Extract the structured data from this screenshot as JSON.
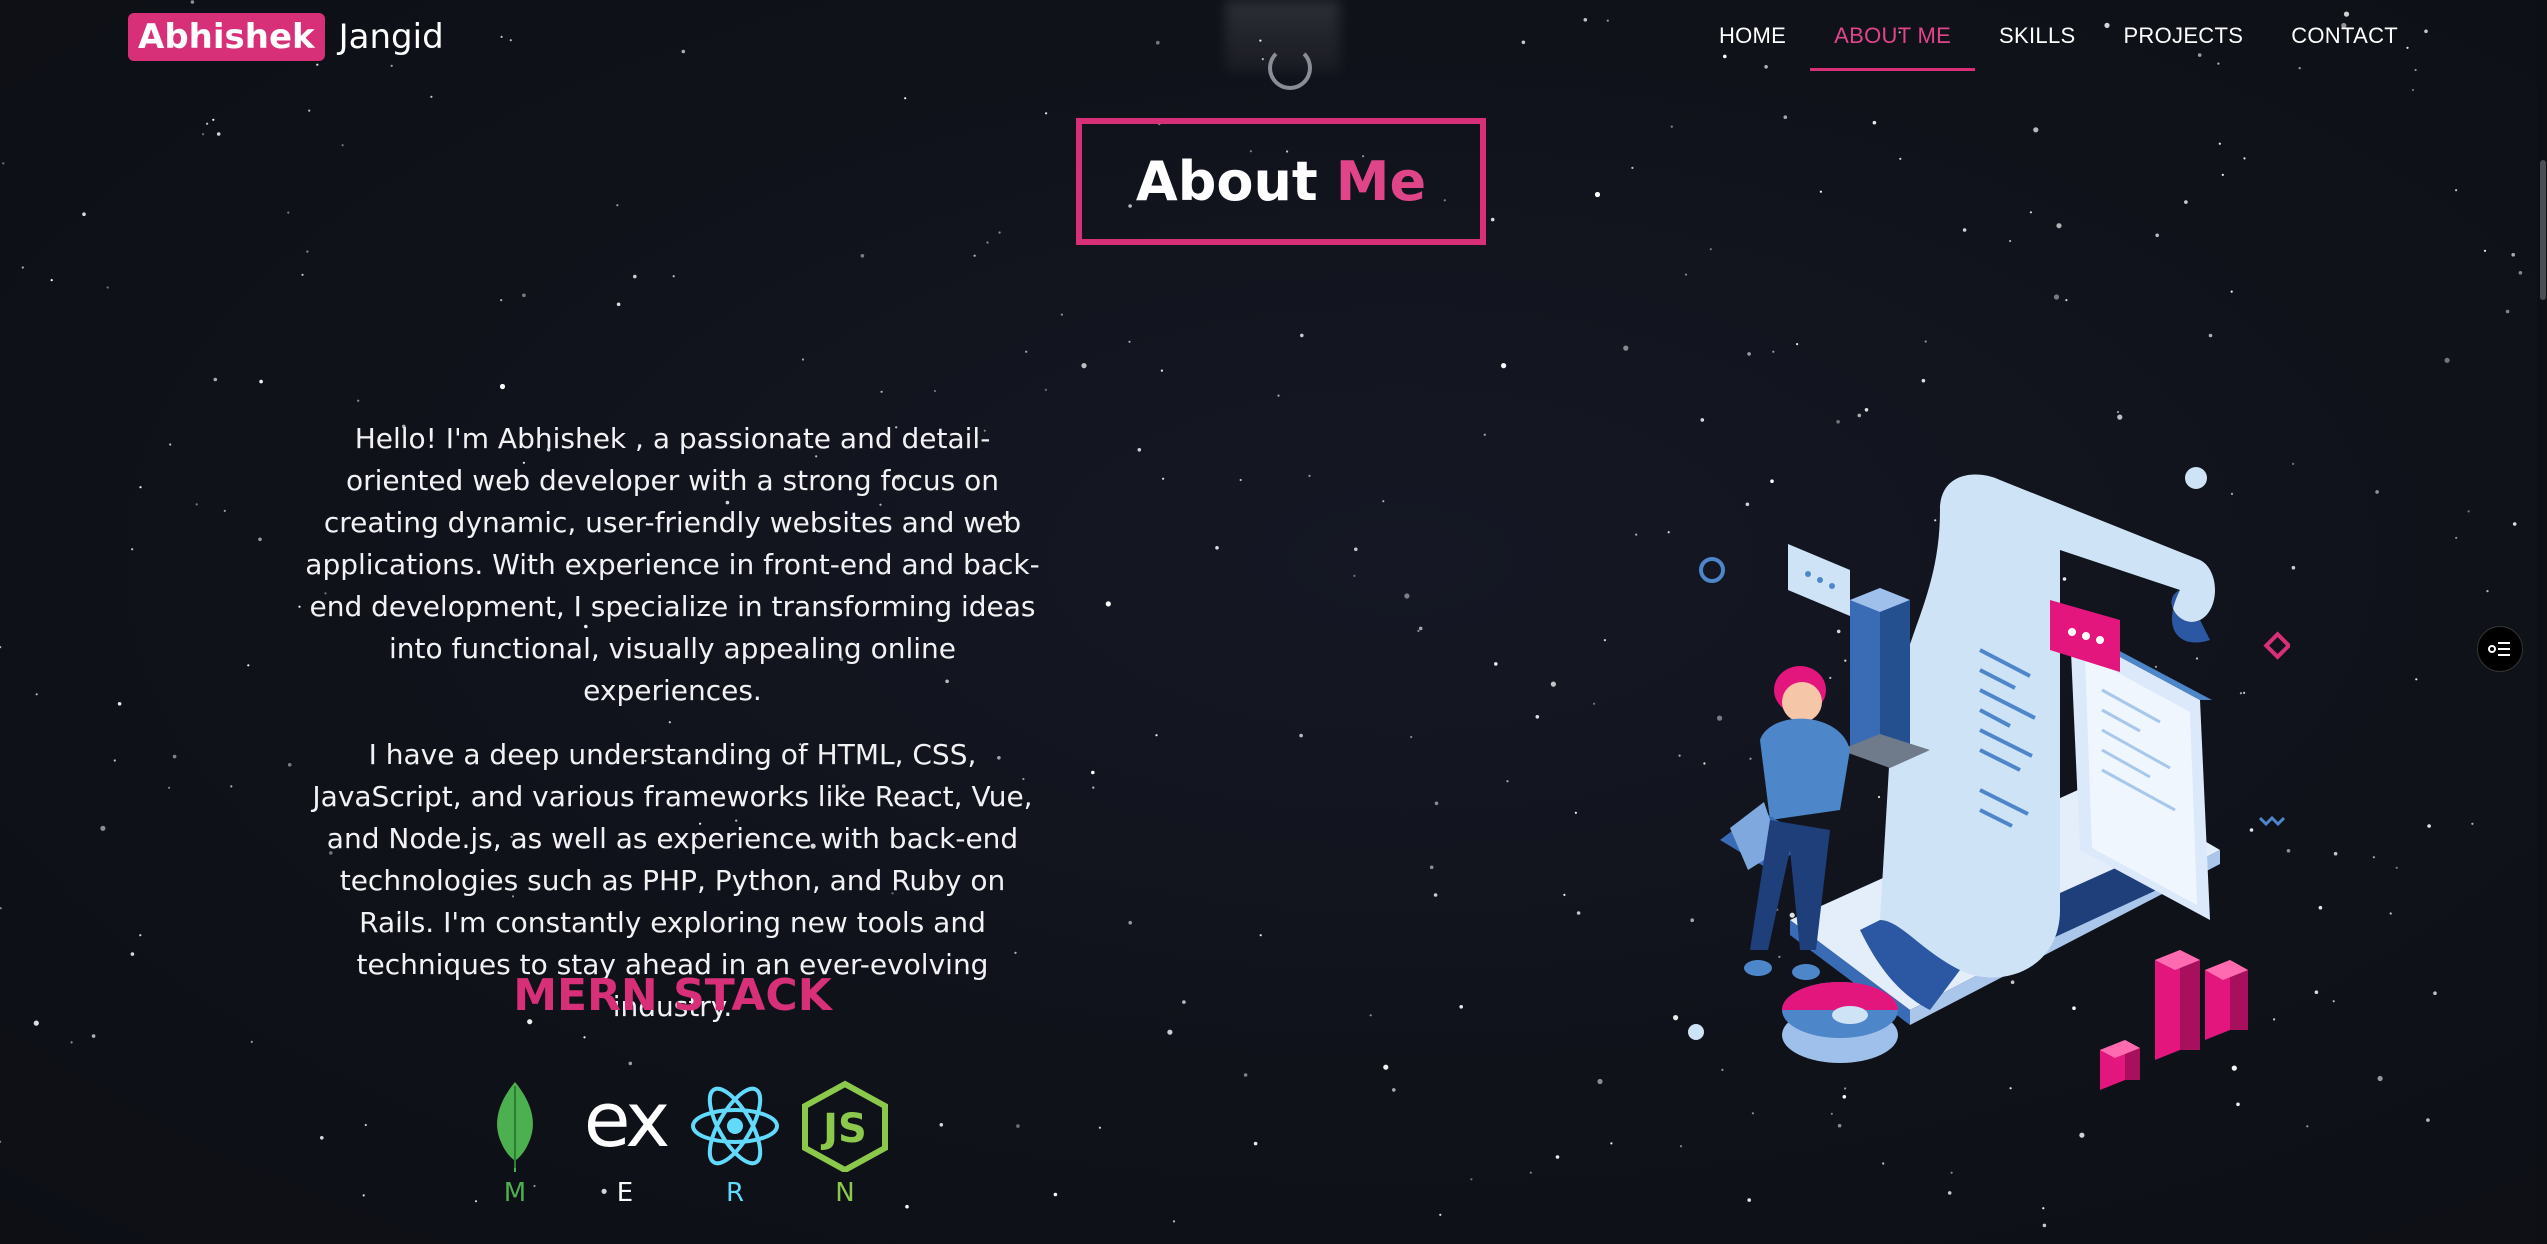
{
  "navbar": {
    "logo_first": "Abhishek",
    "logo_last": "Jangid",
    "links": [
      "HOME",
      "ABOUT ME",
      "SKILLS",
      "PROJECTS",
      "CONTACT"
    ],
    "active": "ABOUT ME"
  },
  "section": {
    "title_word1": "About",
    "title_word2": "Me",
    "paragraph1": "Hello! I'm Abhishek , a passionate and detail-oriented web developer with a strong focus on creating dynamic, user-friendly websites and web applications. With experience in front-end and back-end development, I specialize in transforming ideas into functional, visually appealing online experiences.",
    "paragraph2": "I have a deep understanding of HTML, CSS, JavaScript, and various frameworks like React, Vue, and Node.js, as well as experience with back-end technologies such as PHP, Python, and Ruby on Rails. I'm constantly exploring new tools and techniques to stay ahead in an ever-evolving industry.",
    "stack_title": "MERN STACK",
    "stack": [
      {
        "letter": "M",
        "icon": "mongodb-icon",
        "color": "#4caf50"
      },
      {
        "letter": "E",
        "icon": "express-icon",
        "color": "#ffffff"
      },
      {
        "letter": "R",
        "icon": "react-icon",
        "color": "#61dafb"
      },
      {
        "letter": "N",
        "icon": "nodejs-icon",
        "color": "#8cc84b"
      }
    ]
  },
  "express_mark": "ex",
  "nodejs_mark": "JS",
  "colors": {
    "accent": "#d72f78",
    "background": "#10121a",
    "text": "#ffffff"
  }
}
